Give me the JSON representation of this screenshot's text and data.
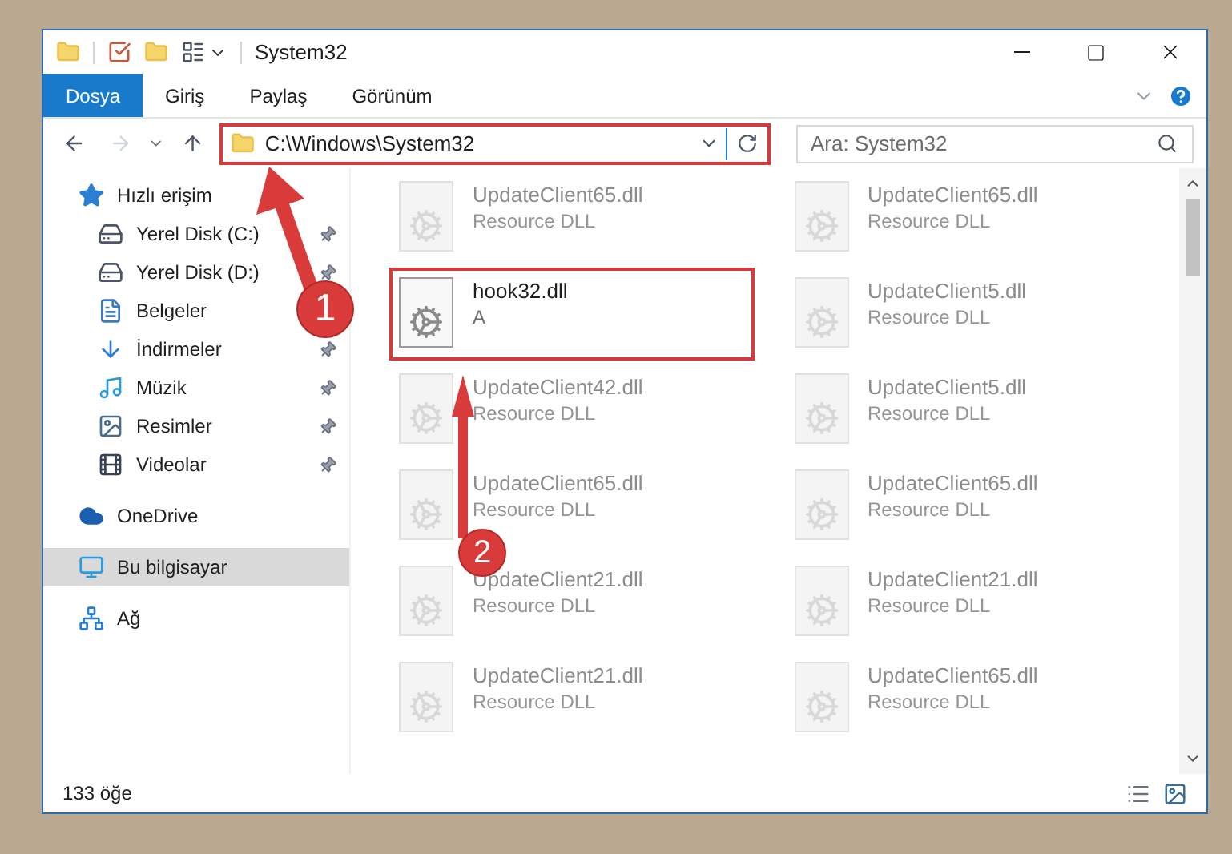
{
  "window": {
    "title": "System32"
  },
  "ribbon_tabs": [
    {
      "label": "Dosya",
      "kind": "file"
    },
    {
      "label": "Giriş",
      "kind": "tab"
    },
    {
      "label": "Paylaş",
      "kind": "tab"
    },
    {
      "label": "Görünüm",
      "kind": "tab"
    }
  ],
  "address_bar": {
    "path": "C:\\Windows\\System32",
    "highlighted": true
  },
  "search": {
    "placeholder": "Ara: System32"
  },
  "sidebar": {
    "items": [
      {
        "label": "Hızlı erişim",
        "kind": "star",
        "selected": false,
        "children": [
          {
            "label": "Yerel Disk (C:)",
            "kind": "drive",
            "pinned": true,
            "selected": false
          },
          {
            "label": "Yerel Disk (D:)",
            "kind": "drive",
            "pinned": true,
            "selected": false
          },
          {
            "label": "Belgeler",
            "kind": "documents",
            "selected": false
          },
          {
            "label": "İndirmeler",
            "kind": "downloads",
            "pinned": true,
            "selected": false
          },
          {
            "label": "Müzik",
            "kind": "music",
            "pinned": true,
            "selected": false
          },
          {
            "label": "Resimler",
            "kind": "pictures",
            "pinned": true,
            "selected": false
          },
          {
            "label": "Videolar",
            "kind": "videos",
            "pinned": true,
            "selected": false
          }
        ]
      },
      {
        "label": "OneDrive",
        "kind": "cloud",
        "selected": false
      },
      {
        "label": "Bu bilgisayar",
        "kind": "computer",
        "selected": true
      },
      {
        "label": "Ağ",
        "kind": "network",
        "selected": false
      }
    ]
  },
  "files": [
    {
      "name": "UpdateClient65.dll",
      "type": "Resource DLL",
      "dimmed": true,
      "highlighted": false
    },
    {
      "name": "UpdateClient65.dll",
      "type": "Resource DLL",
      "dimmed": true,
      "highlighted": false
    },
    {
      "name": "hook32.dll",
      "type": "A",
      "dimmed": false,
      "highlighted": true
    },
    {
      "name": "UpdateClient5.dll",
      "type": "Resource DLL",
      "dimmed": true,
      "highlighted": false
    },
    {
      "name": "UpdateClient42.dll",
      "type": "Resource DLL",
      "dimmed": true,
      "highlighted": false
    },
    {
      "name": "UpdateClient5.dll",
      "type": "Resource DLL",
      "dimmed": true,
      "highlighted": false
    },
    {
      "name": "UpdateClient65.dll",
      "type": "Resource DLL",
      "dimmed": true,
      "highlighted": false
    },
    {
      "name": "UpdateClient65.dll",
      "type": "Resource DLL",
      "dimmed": true,
      "highlighted": false
    },
    {
      "name": "UpdateClient21.dll",
      "type": "Resource DLL",
      "dimmed": true,
      "highlighted": false
    },
    {
      "name": "UpdateClient21.dll",
      "type": "Resource DLL",
      "dimmed": true,
      "highlighted": false
    },
    {
      "name": "UpdateClient21.dll",
      "type": "Resource DLL",
      "dimmed": true,
      "highlighted": false
    },
    {
      "name": "UpdateClient65.dll",
      "type": "Resource DLL",
      "dimmed": true,
      "highlighted": false
    }
  ],
  "status_bar": {
    "item_count": "133 öğe"
  },
  "annotations": [
    {
      "number": "1"
    },
    {
      "number": "2"
    }
  ]
}
